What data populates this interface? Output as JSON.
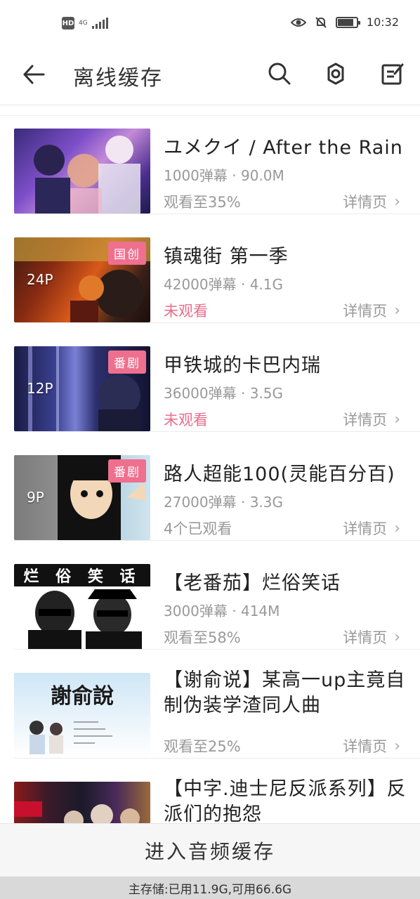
{
  "status_bar": {
    "hd": "HD",
    "network": "4G",
    "time": "10:32",
    "battery_level": 0.85
  },
  "app_bar": {
    "title": "离线缓存",
    "icons": [
      "back-arrow-icon",
      "search-icon",
      "settings-icon",
      "edit-icon"
    ]
  },
  "items": [
    {
      "title": "ユメクイ / After the Rain",
      "meta": "1000弹幕 · 90.0M",
      "status": "观看至35%",
      "status_pink": false,
      "tag": "",
      "count": "",
      "detail": "详情页"
    },
    {
      "title": "镇魂街 第一季",
      "meta": "42000弹幕 · 4.1G",
      "status": "未观看",
      "status_pink": true,
      "tag": "国创",
      "count": "24P",
      "detail": "详情页"
    },
    {
      "title": "甲铁城的卡巴内瑞",
      "meta": "36000弹幕 · 3.5G",
      "status": "未观看",
      "status_pink": true,
      "tag": "番剧",
      "count": "12P",
      "detail": "详情页"
    },
    {
      "title": "路人超能100(灵能百分百)",
      "meta": "27000弹幕 · 3.3G",
      "status": "4个已观看",
      "status_pink": false,
      "tag": "番剧",
      "count": "9P",
      "detail": "详情页"
    },
    {
      "title": "【老番茄】烂俗笑话",
      "meta": "3000弹幕 · 414M",
      "status": "观看至58%",
      "status_pink": false,
      "tag": "",
      "count": "",
      "detail": "详情页",
      "thumb_text": "烂 俗 笑 话"
    },
    {
      "title": "【谢俞说】某高一up主竟自制伪装学渣同人曲",
      "meta": "",
      "status": "观看至25%",
      "status_pink": false,
      "tag": "",
      "count": "",
      "detail": "详情页",
      "thumb_text": "謝俞說"
    },
    {
      "title": "【中字.迪士尼反派系列】反派们的抱怨",
      "meta": "",
      "status": "",
      "status_pink": false,
      "tag": "",
      "count": "",
      "detail": ""
    }
  ],
  "footer": {
    "audio_cache": "进入音频缓存",
    "storage": "主存储:已用11.9G,可用66.6G"
  },
  "colors": {
    "accent_pink": "#ea6d8c",
    "tag_pink": "#ef6f8e"
  }
}
